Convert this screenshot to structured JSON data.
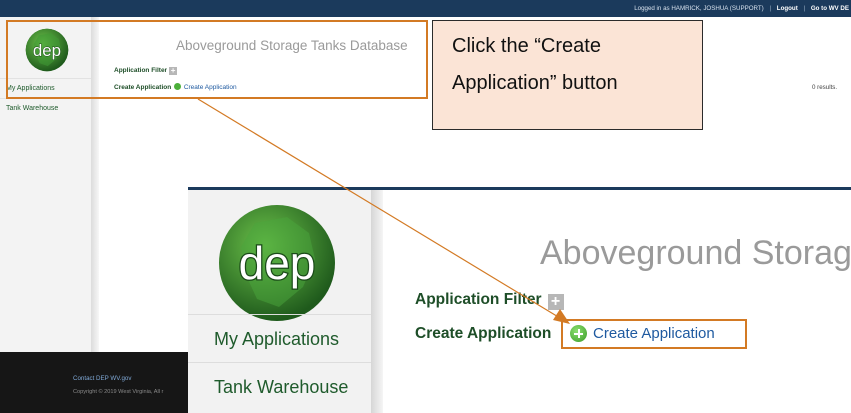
{
  "topbar": {
    "logged_in": "Logged in as HAMRICK, JOSHUA (SUPPORT)",
    "sep1": "|",
    "logout": "Logout",
    "sep2": "|",
    "goto": "Go to WV DE"
  },
  "brand": {
    "logo_text": "dep",
    "logo_color": "#2e7d2e"
  },
  "sidebar": {
    "items": [
      {
        "label": "My Applications"
      },
      {
        "label": "Tank Warehouse"
      }
    ]
  },
  "main": {
    "title": "Aboveground Storage Tanks Database",
    "filter_label": "Application Filter",
    "create_label": "Create Application",
    "create_button": "Create Application",
    "results": "0 results."
  },
  "footer": {
    "links": "Contact DEP   WV.gov",
    "copyright": "Copyright © 2019 West Virginia, All r"
  },
  "callout": {
    "line1": "Click the “Create",
    "line2": "Application” button"
  },
  "inset": {
    "title": "Aboveground Storage",
    "filter_label": "Application Filter",
    "create_label": "Create Application",
    "create_button": "Create Application",
    "nav": [
      {
        "label": "My Applications"
      },
      {
        "label": "Tank Warehouse"
      }
    ]
  },
  "colors": {
    "accent": "#d37a24",
    "callout_bg": "#fbe4d6",
    "nav_green": "#1f5b2c",
    "link_blue": "#1f5aa0"
  }
}
